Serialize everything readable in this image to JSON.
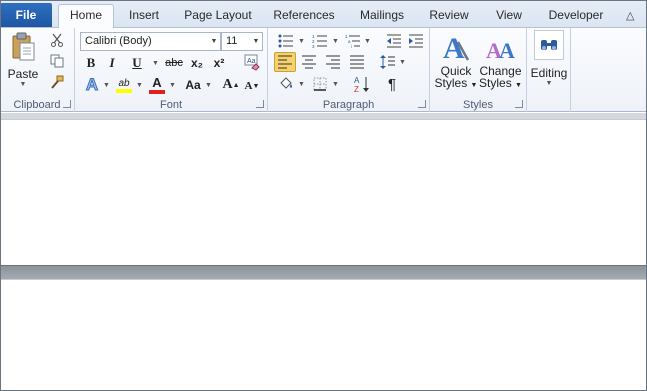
{
  "tabs": {
    "file": "File",
    "home": "Home",
    "insert": "Insert",
    "page_layout": "Page Layout",
    "references": "References",
    "mailings": "Mailings",
    "review": "Review",
    "view": "View",
    "developer": "Developer"
  },
  "clipboard": {
    "paste_label": "Paste",
    "group_label": "Clipboard"
  },
  "font": {
    "font_name": "Calibri (Body)",
    "font_size": "11",
    "group_label": "Font",
    "bold": "B",
    "italic": "I",
    "underline": "U",
    "strikethrough": "abc",
    "subscript": "x₂",
    "superscript": "x²",
    "grow_font": "A",
    "shrink_font": "A",
    "change_case": "Aa",
    "highlight_text": "ab",
    "font_color_text": "A",
    "text_effects_text": "A"
  },
  "paragraph": {
    "group_label": "Paragraph",
    "pilcrow": "¶"
  },
  "styles": {
    "quick_line1": "Quick",
    "quick_line2": "Styles",
    "change_line1": "Change",
    "change_line2": "Styles",
    "group_label": "Styles"
  },
  "editing": {
    "label": "Editing"
  },
  "colors": {
    "file_tab": "#2a64b4",
    "highlight": "#ffff00",
    "font_color": "#e02020",
    "align_left_active": "#f7d26a"
  }
}
